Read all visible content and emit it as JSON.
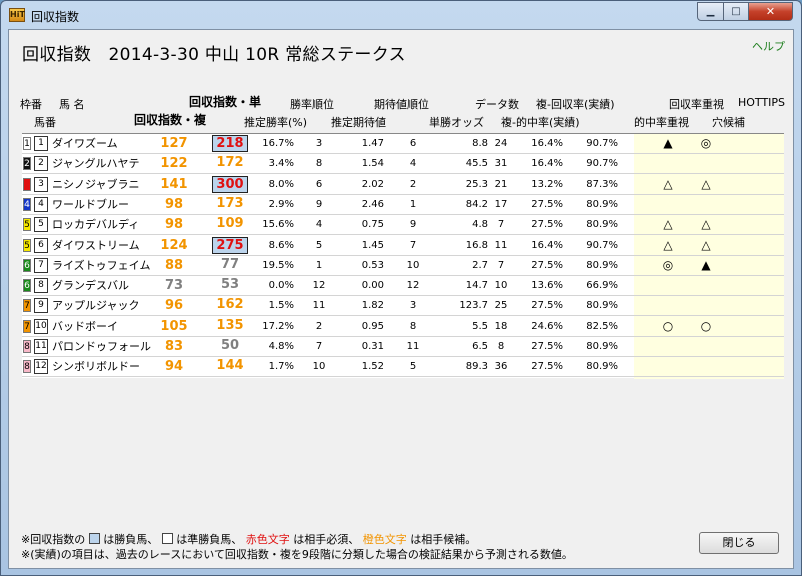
{
  "window": {
    "title": "回収指数",
    "icon_text": "HiT",
    "minimize_glyph": "▁",
    "maximize_glyph": "□",
    "close_glyph": "✕"
  },
  "page_title": "回収指数　2014-3-30 中山 10R 常総ステークス",
  "help_link": "ヘルプ",
  "headers": {
    "waku": "枠番",
    "horse_name": "馬 名",
    "umaban": "馬番",
    "index_win": "回収指数・単",
    "index_place": "回収指数・複",
    "win_rank": "勝率順位",
    "est_win_rate": "推定勝率(%)",
    "ev_rank": "期待値順位",
    "est_ev": "推定期待値",
    "data_count": "データ数",
    "win_odds": "単勝オッズ",
    "place_return_hist": "複-回収率(実績)",
    "place_hit_hist": "複-的中率(実績)",
    "focus_return": "回収率重視",
    "focus_hit": "的中率重視",
    "hottips": "HOTTIPS",
    "dark_horse": "穴候補"
  },
  "colors": {
    "orange_text": "#f29400",
    "red_text": "#e01010",
    "gray_text": "#808080",
    "highlight_box": "#bcd4ec",
    "yellow_column": "#ffffe0"
  },
  "rows": [
    {
      "waku": "1",
      "waku_bg": "#ffffff",
      "waku_fg": "#000000",
      "umaban": "1",
      "name": "ダイワズーム",
      "idx_win": "127",
      "idx_win_color": "#f29400",
      "idx_place": "218",
      "idx_place_color": "#e01010",
      "idx_place_boxed": true,
      "est_win_rate": "16.7%",
      "win_rank": "3",
      "est_ev": "1.47",
      "ev_rank": "6",
      "win_odds": "8.8",
      "data_count": "24",
      "hit_rate": "16.4%",
      "return_rate": "90.7%",
      "mark_hit": "▲",
      "mark_return": "◎"
    },
    {
      "waku": "2",
      "waku_bg": "#111111",
      "waku_fg": "#ffffff",
      "umaban": "2",
      "name": "ジャングルハヤテ",
      "idx_win": "122",
      "idx_win_color": "#f29400",
      "idx_place": "172",
      "idx_place_color": "#f29400",
      "idx_place_boxed": false,
      "est_win_rate": "3.4%",
      "win_rank": "8",
      "est_ev": "1.54",
      "ev_rank": "4",
      "win_odds": "45.5",
      "data_count": "31",
      "hit_rate": "16.4%",
      "return_rate": "90.7%",
      "mark_hit": "",
      "mark_return": ""
    },
    {
      "waku": "3",
      "waku_bg": "#e01010",
      "waku_fg": "#e01010",
      "umaban": "3",
      "name": "ニシノジャブラニ",
      "idx_win": "141",
      "idx_win_color": "#f29400",
      "idx_place": "300",
      "idx_place_color": "#e01010",
      "idx_place_boxed": true,
      "est_win_rate": "8.0%",
      "win_rank": "6",
      "est_ev": "2.02",
      "ev_rank": "2",
      "win_odds": "25.3",
      "data_count": "21",
      "hit_rate": "13.2%",
      "return_rate": "87.3%",
      "mark_hit": "△",
      "mark_return": "△"
    },
    {
      "waku": "4",
      "waku_bg": "#1436c8",
      "waku_fg": "#ffffff",
      "umaban": "4",
      "name": "ワールドブルー",
      "idx_win": "98",
      "idx_win_color": "#f29400",
      "idx_place": "173",
      "idx_place_color": "#f29400",
      "idx_place_boxed": false,
      "est_win_rate": "2.9%",
      "win_rank": "9",
      "est_ev": "2.46",
      "ev_rank": "1",
      "win_odds": "84.2",
      "data_count": "17",
      "hit_rate": "27.5%",
      "return_rate": "80.9%",
      "mark_hit": "",
      "mark_return": ""
    },
    {
      "waku": "5",
      "waku_bg": "#f5e800",
      "waku_fg": "#000000",
      "umaban": "5",
      "name": "ロッカデバルディ",
      "idx_win": "98",
      "idx_win_color": "#f29400",
      "idx_place": "109",
      "idx_place_color": "#f29400",
      "idx_place_boxed": false,
      "est_win_rate": "15.6%",
      "win_rank": "4",
      "est_ev": "0.75",
      "ev_rank": "9",
      "win_odds": "4.8",
      "data_count": "7",
      "hit_rate": "27.5%",
      "return_rate": "80.9%",
      "mark_hit": "△",
      "mark_return": "△"
    },
    {
      "waku": "5",
      "waku_bg": "#f5e800",
      "waku_fg": "#000000",
      "umaban": "6",
      "name": "ダイワストリーム",
      "idx_win": "124",
      "idx_win_color": "#f29400",
      "idx_place": "275",
      "idx_place_color": "#e01010",
      "idx_place_boxed": true,
      "est_win_rate": "8.6%",
      "win_rank": "5",
      "est_ev": "1.45",
      "ev_rank": "7",
      "win_odds": "16.8",
      "data_count": "11",
      "hit_rate": "16.4%",
      "return_rate": "90.7%",
      "mark_hit": "△",
      "mark_return": "△"
    },
    {
      "waku": "6",
      "waku_bg": "#1a8a1a",
      "waku_fg": "#ffffff",
      "umaban": "7",
      "name": "ライズトゥフェイム",
      "idx_win": "88",
      "idx_win_color": "#f29400",
      "idx_place": "77",
      "idx_place_color": "#808080",
      "idx_place_boxed": false,
      "est_win_rate": "19.5%",
      "win_rank": "1",
      "est_ev": "0.53",
      "ev_rank": "10",
      "win_odds": "2.7",
      "data_count": "7",
      "hit_rate": "27.5%",
      "return_rate": "80.9%",
      "mark_hit": "◎",
      "mark_return": "▲"
    },
    {
      "waku": "6",
      "waku_bg": "#1a8a1a",
      "waku_fg": "#ffffff",
      "umaban": "8",
      "name": "グランデスバル",
      "idx_win": "73",
      "idx_win_color": "#808080",
      "idx_place": "53",
      "idx_place_color": "#808080",
      "idx_place_boxed": false,
      "est_win_rate": "0.0%",
      "win_rank": "12",
      "est_ev": "0.00",
      "ev_rank": "12",
      "win_odds": "14.7",
      "data_count": "10",
      "hit_rate": "13.6%",
      "return_rate": "66.9%",
      "mark_hit": "",
      "mark_return": ""
    },
    {
      "waku": "7",
      "waku_bg": "#f29400",
      "waku_fg": "#000000",
      "umaban": "9",
      "name": "アップルジャック",
      "idx_win": "96",
      "idx_win_color": "#f29400",
      "idx_place": "162",
      "idx_place_color": "#f29400",
      "idx_place_boxed": false,
      "est_win_rate": "1.5%",
      "win_rank": "11",
      "est_ev": "1.82",
      "ev_rank": "3",
      "win_odds": "123.7",
      "data_count": "25",
      "hit_rate": "27.5%",
      "return_rate": "80.9%",
      "mark_hit": "",
      "mark_return": ""
    },
    {
      "waku": "7",
      "waku_bg": "#f29400",
      "waku_fg": "#000000",
      "umaban": "10",
      "name": "バッドボーイ",
      "idx_win": "105",
      "idx_win_color": "#f29400",
      "idx_place": "135",
      "idx_place_color": "#f29400",
      "idx_place_boxed": false,
      "est_win_rate": "17.2%",
      "win_rank": "2",
      "est_ev": "0.95",
      "ev_rank": "8",
      "win_odds": "5.5",
      "data_count": "18",
      "hit_rate": "24.6%",
      "return_rate": "82.5%",
      "mark_hit": "○",
      "mark_return": "○"
    },
    {
      "waku": "8",
      "waku_bg": "#f7b8c8",
      "waku_fg": "#000000",
      "umaban": "11",
      "name": "パロンドゥフォール",
      "idx_win": "83",
      "idx_win_color": "#f29400",
      "idx_place": "50",
      "idx_place_color": "#808080",
      "idx_place_boxed": false,
      "est_win_rate": "4.8%",
      "win_rank": "7",
      "est_ev": "0.31",
      "ev_rank": "11",
      "win_odds": "6.5",
      "data_count": "8",
      "hit_rate": "27.5%",
      "return_rate": "80.9%",
      "mark_hit": "",
      "mark_return": ""
    },
    {
      "waku": "8",
      "waku_bg": "#f7b8c8",
      "waku_fg": "#000000",
      "umaban": "12",
      "name": "シンボリボルドー",
      "idx_win": "94",
      "idx_win_color": "#f29400",
      "idx_place": "144",
      "idx_place_color": "#f29400",
      "idx_place_boxed": false,
      "est_win_rate": "1.7%",
      "win_rank": "10",
      "est_ev": "1.52",
      "ev_rank": "5",
      "win_odds": "89.3",
      "data_count": "36",
      "hit_rate": "27.5%",
      "return_rate": "80.9%",
      "mark_hit": "",
      "mark_return": ""
    }
  ],
  "footnotes": {
    "line1_a": "※回収指数の",
    "line1_b": "は勝負馬、",
    "line1_c": "は準勝負馬、",
    "line1_red": "赤色文字",
    "line1_d": "は相手必須、",
    "line1_orange": "橙色文字",
    "line1_e": "は相手候補。",
    "line2": "※(実績)の項目は、過去のレースにおいて回収指数・複を9段階に分類した場合の検証結果から予測される数値。"
  },
  "close_button": "閉じる"
}
